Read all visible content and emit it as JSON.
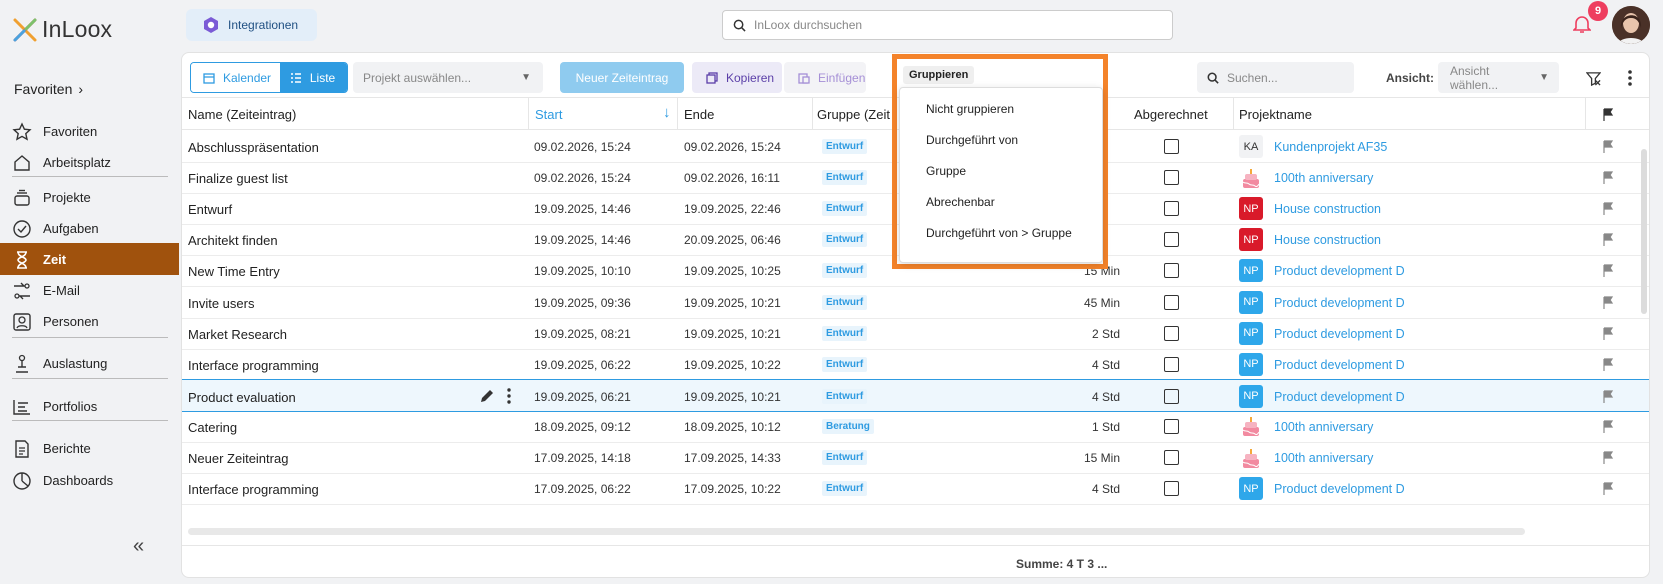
{
  "app": {
    "name": "InLoox"
  },
  "sidebar": {
    "favorites_header": "Favoriten",
    "items": [
      {
        "label": "Favoriten",
        "icon": "star-icon"
      },
      {
        "label": "Arbeitsplatz",
        "icon": "home-icon"
      },
      {
        "label": "Projekte",
        "icon": "layers-icon"
      },
      {
        "label": "Aufgaben",
        "icon": "check-circle-icon"
      },
      {
        "label": "Zeit",
        "icon": "hourglass-icon"
      },
      {
        "label": "E-Mail",
        "icon": "email-route-icon"
      },
      {
        "label": "Personen",
        "icon": "person-card-icon"
      },
      {
        "label": "Auslastung",
        "icon": "workload-icon"
      },
      {
        "label": "Portfolios",
        "icon": "portfolio-icon"
      },
      {
        "label": "Berichte",
        "icon": "report-icon"
      },
      {
        "label": "Dashboards",
        "icon": "pie-chart-icon"
      }
    ],
    "active_item": "Zeit",
    "active_color": "#a0520d"
  },
  "header": {
    "integrations_label": "Integrationen",
    "search_placeholder": "InLoox durchsuchen",
    "notification_count": "9"
  },
  "toolbar": {
    "calendar_label": "Kalender",
    "list_label": "Liste",
    "project_select_placeholder": "Projekt auswählen...",
    "new_entry_label": "Neuer Zeiteintrag",
    "copy_label": "Kopieren",
    "paste_label": "Einfügen",
    "group_label": "Gruppieren",
    "search_placeholder": "Suchen...",
    "view_label": "Ansicht:",
    "view_select_placeholder": "Ansicht wählen..."
  },
  "group_menu": {
    "options": [
      "Nicht gruppieren",
      "Durchgeführt von",
      "Gruppe",
      "Abrechenbar",
      "Durchgeführt von > Gruppe"
    ]
  },
  "table": {
    "columns": {
      "name": "Name (Zeiteintrag)",
      "start": "Start",
      "end": "Ende",
      "group": "Gruppe (Zeit",
      "billed": "Abgerechnet",
      "project": "Projektname"
    },
    "rows": [
      {
        "name": "Abschlusspräsentation",
        "start": "09.02.2026, 15:24",
        "end": "09.02.2026, 15:24",
        "group": "Entwurf",
        "duration": "",
        "project": "Kundenprojekt AF35",
        "project_icon": "KA",
        "icon_style": "initials-grey"
      },
      {
        "name": "Finalize guest list",
        "start": "09.02.2026, 15:24",
        "end": "09.02.2026, 16:11",
        "group": "Entwurf",
        "duration": "",
        "project": "100th anniversary",
        "project_icon": "cake-icon",
        "icon_style": "cake"
      },
      {
        "name": "Entwurf",
        "start": "19.09.2025, 14:46",
        "end": "19.09.2025, 22:46",
        "group": "Entwurf",
        "duration": "",
        "project": "House construction",
        "project_icon": "NP",
        "icon_style": "initials-red"
      },
      {
        "name": "Architekt finden",
        "start": "19.09.2025, 14:46",
        "end": "20.09.2025, 06:46",
        "group": "Entwurf",
        "duration": "",
        "project": "House construction",
        "project_icon": "NP",
        "icon_style": "initials-red"
      },
      {
        "name": "New Time Entry",
        "start": "19.09.2025, 10:10",
        "end": "19.09.2025, 10:25",
        "group": "Entwurf",
        "duration": "15 Min",
        "project": "Product development D",
        "project_icon": "NP",
        "icon_style": "initials-blue"
      },
      {
        "name": "Invite users",
        "start": "19.09.2025, 09:36",
        "end": "19.09.2025, 10:21",
        "group": "Entwurf",
        "duration": "45 Min",
        "project": "Product development D",
        "project_icon": "NP",
        "icon_style": "initials-blue"
      },
      {
        "name": "Market Research",
        "start": "19.09.2025, 08:21",
        "end": "19.09.2025, 10:21",
        "group": "Entwurf",
        "duration": "2 Std",
        "project": "Product development D",
        "project_icon": "NP",
        "icon_style": "initials-blue"
      },
      {
        "name": "Interface programming",
        "start": "19.09.2025, 06:22",
        "end": "19.09.2025, 10:22",
        "group": "Entwurf",
        "duration": "4 Std",
        "project": "Product development D",
        "project_icon": "NP",
        "icon_style": "initials-blue"
      },
      {
        "name": "Product evaluation",
        "start": "19.09.2025, 06:21",
        "end": "19.09.2025, 10:21",
        "group": "Entwurf",
        "duration": "4 Std",
        "project": "Product development D",
        "project_icon": "NP",
        "icon_style": "initials-blue",
        "selected": true
      },
      {
        "name": "Catering",
        "start": "18.09.2025, 09:12",
        "end": "18.09.2025, 10:12",
        "group": "Beratung",
        "duration": "1 Std",
        "project": "100th anniversary",
        "project_icon": "cake-icon",
        "icon_style": "cake"
      },
      {
        "name": "Neuer Zeiteintrag",
        "start": "17.09.2025, 14:18",
        "end": "17.09.2025, 14:33",
        "group": "Entwurf",
        "duration": "15 Min",
        "project": "100th anniversary",
        "project_icon": "cake-icon",
        "icon_style": "cake"
      },
      {
        "name": "Interface programming",
        "start": "17.09.2025, 06:22",
        "end": "17.09.2025, 10:22",
        "group": "Entwurf",
        "duration": "4 Std",
        "project": "Product development D",
        "project_icon": "NP",
        "icon_style": "initials-blue"
      }
    ]
  },
  "footer": {
    "sum_label": "Summe: 4 T 3 ..."
  }
}
